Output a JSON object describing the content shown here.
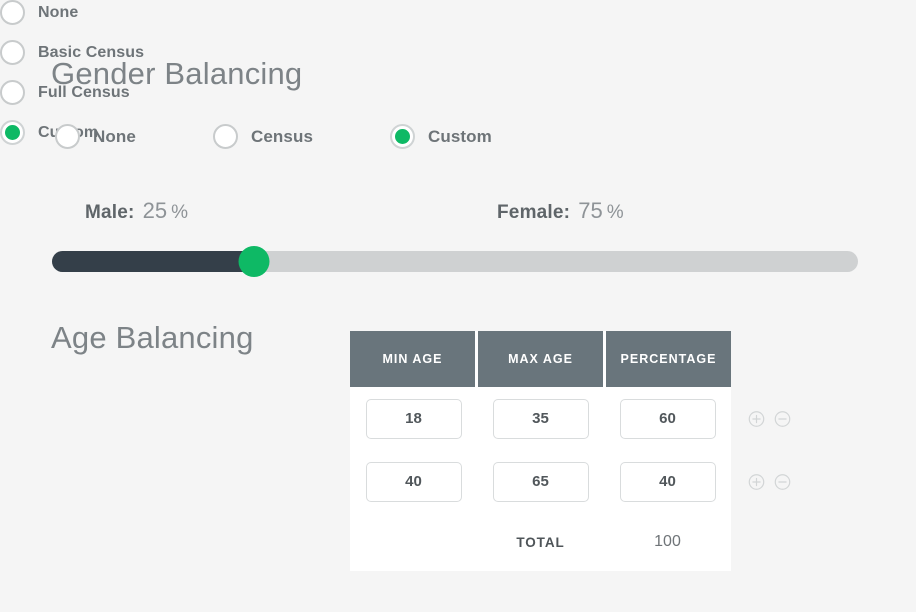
{
  "gender": {
    "title": "Gender Balancing",
    "options": [
      {
        "label": "None",
        "selected": false
      },
      {
        "label": "Census",
        "selected": false
      },
      {
        "label": "Custom",
        "selected": true
      }
    ],
    "male": {
      "name": "Male:",
      "value": "25",
      "unit": "%"
    },
    "female": {
      "name": "Female:",
      "value": "75",
      "unit": "%"
    },
    "slider": {
      "fill_percent": 25
    }
  },
  "age": {
    "title": "Age Balancing",
    "options": [
      {
        "label": "None",
        "selected": false
      },
      {
        "label": "Basic Census",
        "selected": false
      },
      {
        "label": "Full Census",
        "selected": false
      },
      {
        "label": "Custom",
        "selected": true
      }
    ],
    "table": {
      "headers": [
        "MIN AGE",
        "MAX AGE",
        "PERCENTAGE"
      ],
      "rows": [
        {
          "min_age": "18",
          "max_age": "35",
          "percentage": "60",
          "add_icon": "circle-plus-icon",
          "remove_icon": "circle-minus-icon"
        },
        {
          "min_age": "40",
          "max_age": "65",
          "percentage": "40",
          "add_icon": "circle-plus-icon",
          "remove_icon": "circle-minus-icon"
        }
      ],
      "total_label": "TOTAL",
      "total_value": "100"
    }
  },
  "colors": {
    "background": "#f5f5f5",
    "accent_green": "#0eb965",
    "slider_fill": "#343f49",
    "slider_track": "#cfd1d2",
    "table_header": "#69757c",
    "heading_text": "#7d8387"
  }
}
